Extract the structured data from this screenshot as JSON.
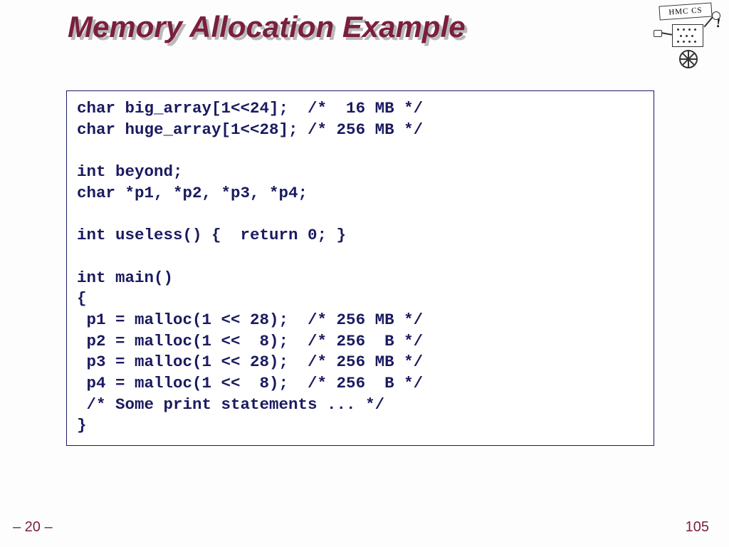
{
  "title": "Memory Allocation Example",
  "logo_banner": "HMC  CS",
  "logo_bang": "!",
  "code": "char big_array[1<<24];  /*  16 MB */\nchar huge_array[1<<28]; /* 256 MB */\n\nint beyond;\nchar *p1, *p2, *p3, *p4;\n\nint useless() {  return 0; }\n\nint main()\n{\n p1 = malloc(1 << 28);  /* 256 MB */\n p2 = malloc(1 <<  8);  /* 256  B */\n p3 = malloc(1 << 28);  /* 256 MB */\n p4 = malloc(1 <<  8);  /* 256  B */\n /* Some print statements ... */\n}",
  "footer_left": "– 20 –",
  "footer_right": "105"
}
